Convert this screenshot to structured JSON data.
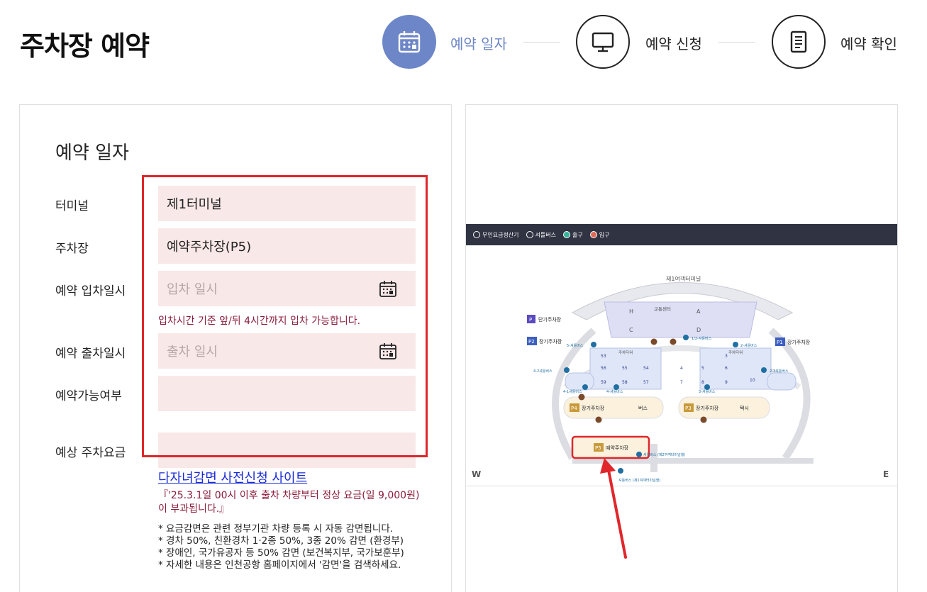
{
  "page_title": "주차장 예약",
  "steps": [
    {
      "label": "예약 일자",
      "icon": "calendar-icon",
      "active": true
    },
    {
      "label": "예약 신청",
      "icon": "monitor-icon",
      "active": false
    },
    {
      "label": "예약 확인",
      "icon": "document-icon",
      "active": false
    }
  ],
  "colors": {
    "accent": "#6d86c7",
    "field_bg": "#f9e8e8",
    "highlight_border": "#e0262b",
    "notice_text": "#8a1c3c",
    "link": "#1a2bd6"
  },
  "form": {
    "title": "예약 일자",
    "terminal": {
      "label": "터미널",
      "value": "제1터미널"
    },
    "parking": {
      "label": "주차장",
      "value": "예약주차장(P5)"
    },
    "entry": {
      "label": "예약 입차일시",
      "placeholder": "입차 일시"
    },
    "entry_hint": "입차시간 기준 앞/뒤 4시간까지 입차 가능합니다.",
    "exit": {
      "label": "예약 출차일시",
      "placeholder": "출차 일시"
    },
    "availability": {
      "label": "예약가능여부",
      "value": ""
    },
    "fee": {
      "label": "예상 주차요금",
      "value": ""
    },
    "discount_link": "다자녀감면 사전신청 사이트",
    "notice": "『'25.3.1일 00시 이후 출차 차량부터 정상 요금(일 9,000원)이 부과됩니다.』",
    "notes": [
      "* 요금감면은 관련 정부기관 차량 등록 시 자동 감면됩니다.",
      "* 경차 50%, 친환경차 1·2종 50%, 3종 20% 감면 (환경부)",
      "* 장애인, 국가유공자 등 50% 감면 (보건복지부, 국가보훈부)",
      "* 자세한 내용은 인천공항 홈페이지에서 '감면'을 검색하세요."
    ]
  },
  "map": {
    "legend": [
      "무인요금정산기",
      "셔틀버스",
      "출구",
      "입구"
    ],
    "terminal_label": "제1여객터미널",
    "transport_center": "교통센터",
    "zones": [
      "H",
      "A",
      "C",
      "D"
    ],
    "parking_tower": "주차타워",
    "p_short": {
      "badge": "P",
      "label": "단기주차장"
    },
    "p1": {
      "badge": "P1",
      "label": "장기주차장"
    },
    "p2": {
      "badge": "P2",
      "label": "장기주차장"
    },
    "p3": {
      "badge": "P3",
      "label": "장기주차장",
      "extra": "택시"
    },
    "p4": {
      "badge": "P4",
      "label": "장기주차장",
      "extra": "버스"
    },
    "p5": {
      "badge": "P5",
      "label": "예약주차장"
    },
    "left_cells": [
      "53",
      "56",
      "55",
      "54",
      "60",
      "59",
      "58",
      "57"
    ],
    "right_cells": [
      "3",
      "4",
      "5",
      "6",
      "10",
      "7",
      "8",
      "9"
    ],
    "shuttle_labels": [
      "5-셔틀버스",
      "1/2-셔틀버스",
      "2-셔틀버스",
      "4-2셔틀버스",
      "2-3셔틀버스",
      "4-1셔틀버스",
      "4-셔틀버스",
      "3-셔틀버스"
    ],
    "shuttle_p5": "셔틀버스 (제2여객터미널행)",
    "shuttle_p5_2": "셔틀버스 (제1여객터미널행)",
    "west": "W",
    "east": "E"
  }
}
